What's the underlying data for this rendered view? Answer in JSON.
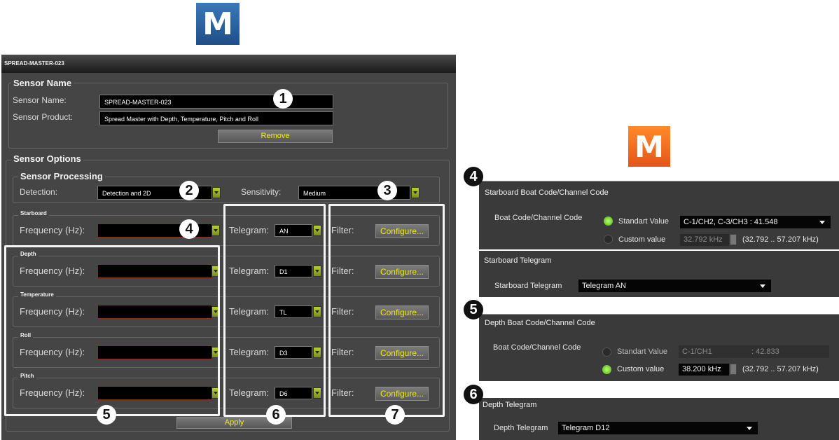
{
  "left": {
    "title": "SPREAD-MASTER-023",
    "sensor_name_group": {
      "legend": "Sensor Name",
      "name_label": "Sensor Name:",
      "name_value": "SPREAD-MASTER-023",
      "product_label": "Sensor Product:",
      "product_value": "Spread Master with Depth, Temperature, Pitch and Roll",
      "remove_label": "Remove"
    },
    "options": {
      "legend": "Sensor Options",
      "processing_legend": "Sensor Processing",
      "detection_label": "Detection:",
      "detection_value": "Detection and 2D",
      "sensitivity_label": "Sensitivity:",
      "sensitivity_value": "Medium"
    },
    "freq_label": "Frequency (Hz):",
    "telegram_label": "Telegram:",
    "filter_label": "Filter:",
    "configure_label": "Configure...",
    "rows": [
      {
        "name": "Starboard",
        "telegram": "AN"
      },
      {
        "name": "Depth",
        "telegram": "D1"
      },
      {
        "name": "Temperature",
        "telegram": "TL"
      },
      {
        "name": "Roll",
        "telegram": "D3"
      },
      {
        "name": "Pitch",
        "telegram": "D6"
      }
    ],
    "apply_label": "Apply"
  },
  "badges": [
    "1",
    "2",
    "3",
    "4",
    "5",
    "6",
    "7",
    "4",
    "5",
    "6"
  ],
  "logo_letter": "M",
  "right": {
    "starboard_code": {
      "title": "Starboard Boat Code/Channel Code",
      "row_label": "Boat Code/Channel Code",
      "standard_label": "Standart Value",
      "standard_value": "C-1/CH2, C-3/CH3 : 41.548",
      "custom_label": "Custom value",
      "custom_value": "32.792 kHz",
      "range": "(32.792 .. 57.207 kHz)"
    },
    "starboard_telegram": {
      "title": "Starboard Telegram",
      "label": "Starboard Telegram",
      "value": "Telegram AN"
    },
    "depth_code": {
      "title": "Depth Boat Code/Channel Code",
      "row_label": "Boat Code/Channel Code",
      "standard_label": "Standart Value",
      "standard_value_a": "C-1/CH1",
      "standard_value_b": ": 42.833",
      "custom_label": "Custom value",
      "custom_value": "38.200 kHz",
      "range": "(32.792 .. 57.207 kHz)"
    },
    "depth_telegram": {
      "title": "Depth Telegram",
      "label": "Depth Telegram",
      "value": "Telegram D12"
    }
  },
  "colors": {
    "panel": "#454545",
    "configure_text": "#ecec00",
    "accent_green": "#7fd42a",
    "logo_blue": "#2f63a3",
    "logo_orange": "#f06b1f"
  }
}
